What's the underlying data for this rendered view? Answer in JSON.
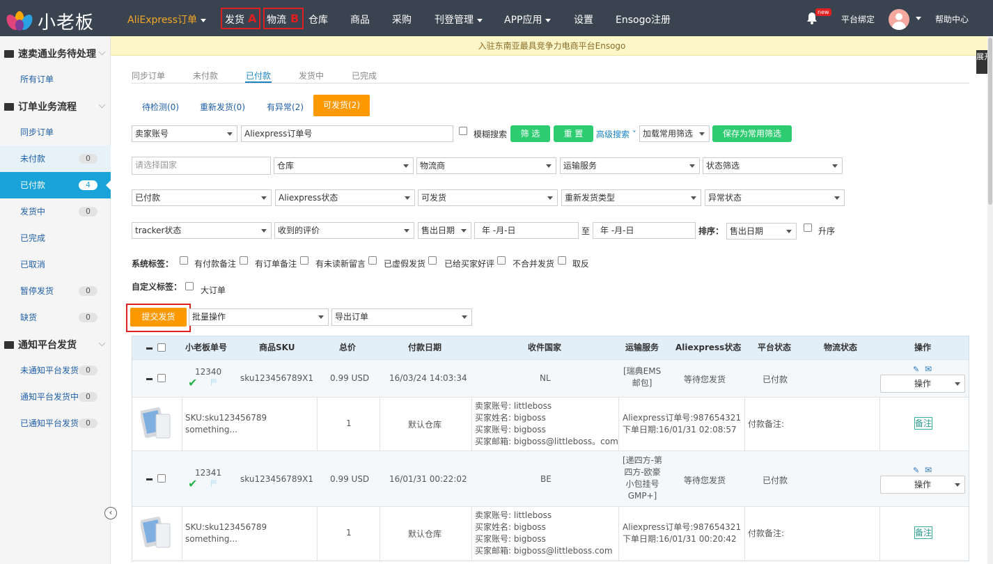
{
  "topbar": {
    "brand": "小老板",
    "nav": [
      "AliExpress订单",
      "发货",
      "物流",
      "仓库",
      "商品",
      "采购",
      "刊登管理",
      "APP应用",
      "设置",
      "Ensogo注册"
    ],
    "annotations": [
      "A",
      "B"
    ],
    "new_badge": "new",
    "platform_bind": "平台绑定",
    "help": "帮助中心"
  },
  "banner": "入驻东南亚最具竞争力电商平台Ensogo",
  "expand_label": "展开",
  "sidebar": {
    "sections": [
      {
        "title": "速卖通业务待处理",
        "items": [
          {
            "label": "所有订单",
            "count": ""
          }
        ]
      },
      {
        "title": "订单业务流程",
        "items": [
          {
            "label": "同步订单",
            "count": ""
          },
          {
            "label": "未付款",
            "count": "0"
          },
          {
            "label": "已付款",
            "count": "4"
          },
          {
            "label": "发货中",
            "count": "0"
          },
          {
            "label": "已完成",
            "count": ""
          },
          {
            "label": "已取消",
            "count": ""
          },
          {
            "label": "暂停发货",
            "count": "0"
          },
          {
            "label": "缺货",
            "count": "0"
          }
        ]
      },
      {
        "title": "通知平台发货",
        "items": [
          {
            "label": "未通知平台发货",
            "count": "0"
          },
          {
            "label": "通知平台发货中",
            "count": "0"
          },
          {
            "label": "已通知平台发货",
            "count": "0"
          }
        ]
      }
    ]
  },
  "tabs": [
    "同步订单",
    "未付款",
    "已付款",
    "发货中",
    "已完成"
  ],
  "subtabs": [
    "待检测(0)",
    "重新发货(0)",
    "有异常(2)",
    "可发货(2)"
  ],
  "filters": {
    "seller_account": "卖家账号",
    "order_no": "Aliexpress订单号",
    "fuzzy": "模糊搜索",
    "filter_btn": "筛 选",
    "reset_btn": "重 置",
    "advanced": "高级搜索",
    "load_common": "加载常用筛选",
    "save_common": "保存为常用筛选",
    "country_placeholder": "请选择国家",
    "warehouse": "仓库",
    "carrier": "物流商",
    "shipping_service": "运输服务",
    "status_filter": "状态筛选",
    "paid": "已付款",
    "ali_status": "Aliexpress状态",
    "shippable": "可发货",
    "reship_type": "重新发货类型",
    "abnormal": "异常状态",
    "tracker": "tracker状态",
    "review": "收到的评价",
    "date_type": "售出日期",
    "date_placeholder": "年 -月-日",
    "to": "至",
    "sort_label": "排序：",
    "sort_value": "售出日期",
    "asc": "升序",
    "sys_tags_label": "系统标签：",
    "sys_tags": [
      "有付款备注",
      "有订单备注",
      "有未读新留言",
      "已虚假发货",
      "已给买家好评",
      "不合并发货",
      "取反"
    ],
    "custom_tags_label": "自定义标签：",
    "custom_tags": [
      "大订单"
    ]
  },
  "actions": {
    "submit": "提交发货",
    "batch": "批量操作",
    "export": "导出订单"
  },
  "table": {
    "headers": [
      "小老板单号",
      "商品SKU",
      "总价",
      "付款日期",
      "收件国家",
      "运输服务",
      "Aliexpress状态",
      "平台状态",
      "物流状态",
      "操作"
    ],
    "orders": [
      {
        "id": "12340",
        "sku": "sku123456789X1",
        "price": "0.99 USD",
        "date": "16/03/24 14:03:34",
        "country": "NL",
        "service": [
          "[瑞典EMS",
          "邮包]"
        ],
        "ali_status": "等待您发货",
        "platform_status": "已付款",
        "op": "操作",
        "item_sku": "SKU:sku123456789",
        "item_name": "something...",
        "qty": "1",
        "warehouse": "默认仓库",
        "buyer_info": [
          "卖家账号: littleboss",
          "买家姓名: bigboss",
          "买家账号: bigboss",
          "买家邮箱: bigboss@littleboss。com"
        ],
        "order_info": [
          "Aliexpress订单号:987654321",
          "下单日期:16/01/31 02:08:57"
        ],
        "pay_note": "付款备注:",
        "note_btn": "备注"
      },
      {
        "id": "12341",
        "sku": "sku123456789X1",
        "price": "0.99 USD",
        "date": "16/01/31 00:22:02",
        "country": "BE",
        "service": [
          "[递四方-第",
          "四方-欧豪",
          "小包挂号",
          "GMP+]"
        ],
        "ali_status": "等待您发货",
        "platform_status": "已付款",
        "op": "操作",
        "item_sku": "SKU:sku123456789",
        "item_name": "something...",
        "qty": "1",
        "warehouse": "默认仓库",
        "buyer_info": [
          "卖家账号: littleboss",
          "买家姓名: bigboss",
          "买家账号: bigboss",
          "买家邮箱: bigboss@littleboss.com"
        ],
        "order_info": [
          "Aliexpress订单号:987654321",
          "下单日期:16/01/31 00:20:42"
        ],
        "pay_note": "付款备注:",
        "note_btn": "备注"
      }
    ]
  },
  "colors": {
    "topbar": "#3a4451",
    "accent": "#1aa3d9",
    "orange": "#ff9900",
    "green": "#2ecc71",
    "annotation": "#e02020"
  }
}
